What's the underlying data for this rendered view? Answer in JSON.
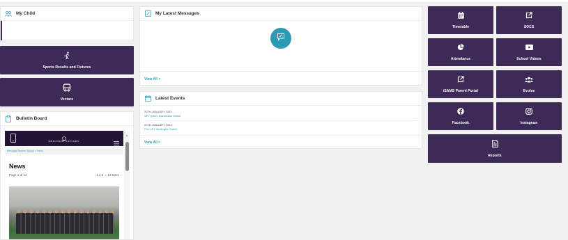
{
  "my_child": {
    "title": "My Child"
  },
  "sports": {
    "label": "Sports Results and Fixtures"
  },
  "vectare": {
    "label": "Vectare"
  },
  "bulletin": {
    "title": "Bulletin Board",
    "site_name": "MERCHANT TAYLORS'",
    "breadcrumb": "Merchant Taylors' School > News",
    "heading": "News",
    "page_info": "Page 1 of 13",
    "pagination": "1 2 3 ... 13 Next"
  },
  "messages": {
    "title": "My Latest Messages",
    "view_all": "View All >"
  },
  "events": {
    "title": "Latest Events",
    "items": [
      {
        "date": "20TH JANUARY 2024",
        "title": "VPL (GBC) Brasenose Match"
      },
      {
        "date": "20TH JANUARY 2024",
        "title": "Pen VPL Wellington Match"
      }
    ],
    "view_all": "View All >"
  },
  "tiles": [
    {
      "label": "Timetable",
      "icon": "calendar-icon"
    },
    {
      "label": "SOCS",
      "icon": "external-link-icon"
    },
    {
      "label": "Attendance",
      "icon": "pie-chart-icon"
    },
    {
      "label": "School Videos",
      "icon": "video-play-icon"
    },
    {
      "label": "iSAMS Parent Portal",
      "icon": "external-link-icon"
    },
    {
      "label": "Evolve",
      "icon": "users-icon"
    },
    {
      "label": "Facebook",
      "icon": "facebook-icon"
    },
    {
      "label": "Instagram",
      "icon": "instagram-icon"
    },
    {
      "label": "Reports",
      "icon": "report-file-icon"
    }
  ],
  "colors": {
    "tile_bg": "#3d2a57",
    "accent": "#2d9ab4"
  }
}
